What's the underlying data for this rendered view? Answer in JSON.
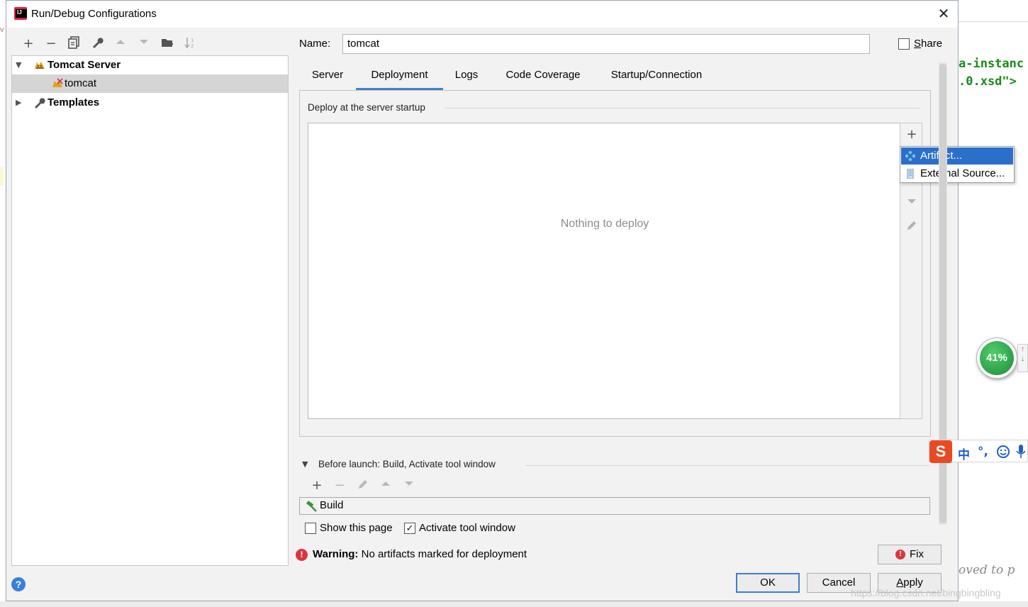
{
  "dialog": {
    "title": "Run/Debug Configurations",
    "close_glyph": "✕"
  },
  "toolbar": {
    "add": "+",
    "remove": "−",
    "copy": "⧉",
    "edit": "🔧",
    "up": "▲",
    "down": "▼",
    "folder": "📁",
    "sort": "⇅"
  },
  "tree": {
    "items": [
      {
        "label": "Tomcat Server",
        "expanded": true,
        "icon": "tomcat-icon"
      },
      {
        "label": "tomcat",
        "selected": true,
        "icon": "tomcat-error-icon"
      },
      {
        "label": "Templates",
        "expanded": false,
        "icon": "wrench-icon"
      }
    ]
  },
  "config": {
    "name_label": "Name:",
    "name_value": "tomcat",
    "share_label": "Share",
    "share_checked": false
  },
  "tabs": [
    {
      "label": "Server",
      "active": false
    },
    {
      "label": "Deployment",
      "active": true
    },
    {
      "label": "Logs",
      "active": false
    },
    {
      "label": "Code Coverage",
      "active": false
    },
    {
      "label": "Startup/Connection",
      "active": false
    }
  ],
  "deployment": {
    "section_title": "Deploy at the server startup",
    "empty_text": "Nothing to deploy",
    "add_glyph": "+",
    "popup": [
      {
        "label": "Artifact...",
        "selected": true,
        "icon": "artifact-icon"
      },
      {
        "label": "External Source...",
        "selected": false,
        "icon": "external-source-icon"
      }
    ]
  },
  "before_launch": {
    "title": "Before launch: Build, Activate tool window",
    "task": "Build",
    "show_page_label": "Show this page",
    "show_page_checked": false,
    "activate_label": "Activate tool window",
    "activate_checked": true
  },
  "warning": {
    "label": "Warning:",
    "text": "No artifacts marked for deployment",
    "fix_label": "Fix"
  },
  "buttons": {
    "ok": "OK",
    "cancel": "Cancel",
    "apply": "Apply",
    "help": "?"
  },
  "background": {
    "code_line1": "a-instanc",
    "code_line2": ".0.xsd\">",
    "code_line3": "oved to p",
    "left_char": "v",
    "watermark": "https://blog.csdn.net/bingbingbling"
  },
  "widgets": {
    "gauge_value": "41%",
    "ime_text1": "中",
    "ime_text2": "°,",
    "ime_logo": "S"
  },
  "colors": {
    "accent": "#4083c9",
    "selection": "#2a6fc9",
    "warning": "#d9363e",
    "code_green": "#1a8a1a"
  }
}
